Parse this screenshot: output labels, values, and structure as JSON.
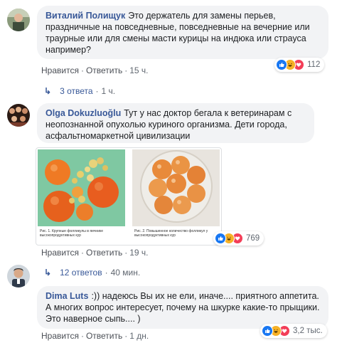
{
  "colors": {
    "link": "#385898",
    "like": "#1877f2",
    "haha": "#f7b125",
    "love": "#f33e58",
    "bubble": "#f2f3f5"
  },
  "comments": [
    {
      "author": "Виталий Полищук",
      "text": "Это держатель для замены перьев, праздничные на повседневные, повседневные на вечерние или траурные или для смены масти курицы на индюка или страуса например?",
      "like": "Нравится",
      "reply": "Ответить",
      "time": "15 ч.",
      "reaction_count": "112",
      "replies_label": "3 ответа",
      "replies_time": "1 ч."
    },
    {
      "author": "Olga Dokuzluoğlu",
      "text": "Тут у нас доктор бегала к ветеринарам с неопознанной опухолью куриного организма. Дети города, асфальтномаркетной цивилизации",
      "like": "Нравится",
      "reply": "Ответить",
      "time": "19 ч.",
      "reaction_count": "769",
      "replies_label": "12 ответов",
      "replies_time": "40 мин.",
      "photo_captions": [
        "Рис. 1. Крупные фолликулы в яичнике высокопродуктивных кур",
        "Рис. 2. Повышенное количество фолликул у высокопродуктивных кур"
      ]
    },
    {
      "author": "Dima Luts",
      "text": ":)) надеюсь Вы их не ели, иначе.... приятного аппетита. А многих вопрос интересует, почему на шкурке какие-то прыщики. Это наверное сыпь.... )",
      "like": "Нравится",
      "reply": "Ответить",
      "time": "1 дн.",
      "reaction_count": "3,2 тыс."
    }
  ]
}
